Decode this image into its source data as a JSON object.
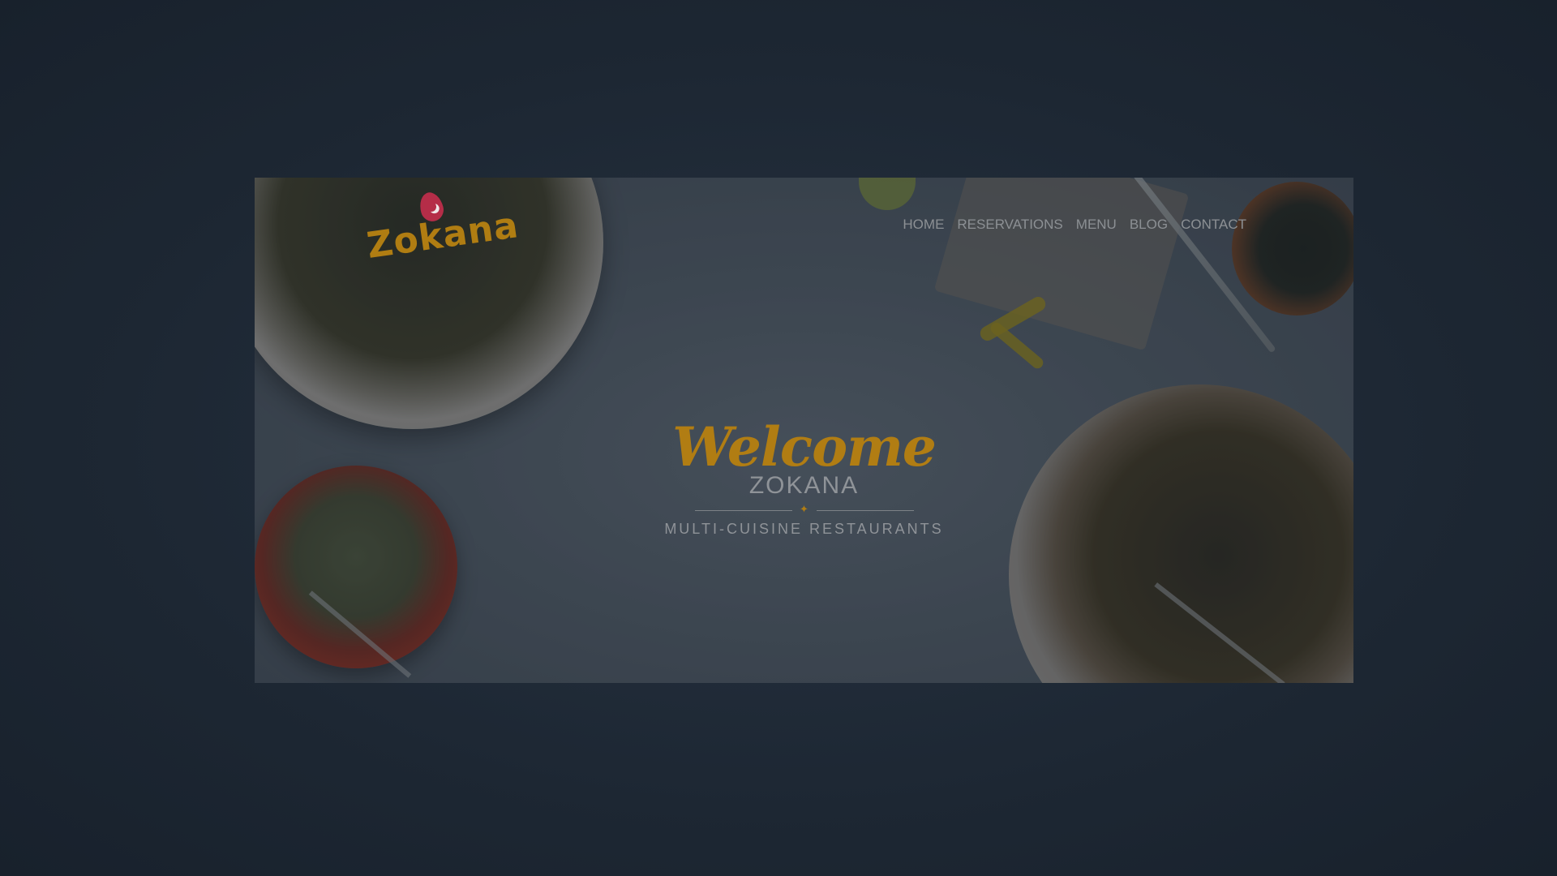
{
  "brand": {
    "logo_text": "Zokana",
    "welcome": "Welcome",
    "name": "ZOKANA",
    "tagline": "MULTI-CUISINE RESTAURANTS",
    "divider_glyph": "✦"
  },
  "nav": {
    "items": [
      {
        "label": "HOME"
      },
      {
        "label": "RESERVATIONS"
      },
      {
        "label": "MENU"
      },
      {
        "label": "BLOG"
      },
      {
        "label": "CONTACT"
      }
    ]
  },
  "colors": {
    "accent": "#b17d13",
    "logo_drop": "#b52d48",
    "backdrop": "#1d2733",
    "text_muted": "#8f9398"
  },
  "icons": [
    "logo-drop-icon",
    "divider-star-icon"
  ]
}
